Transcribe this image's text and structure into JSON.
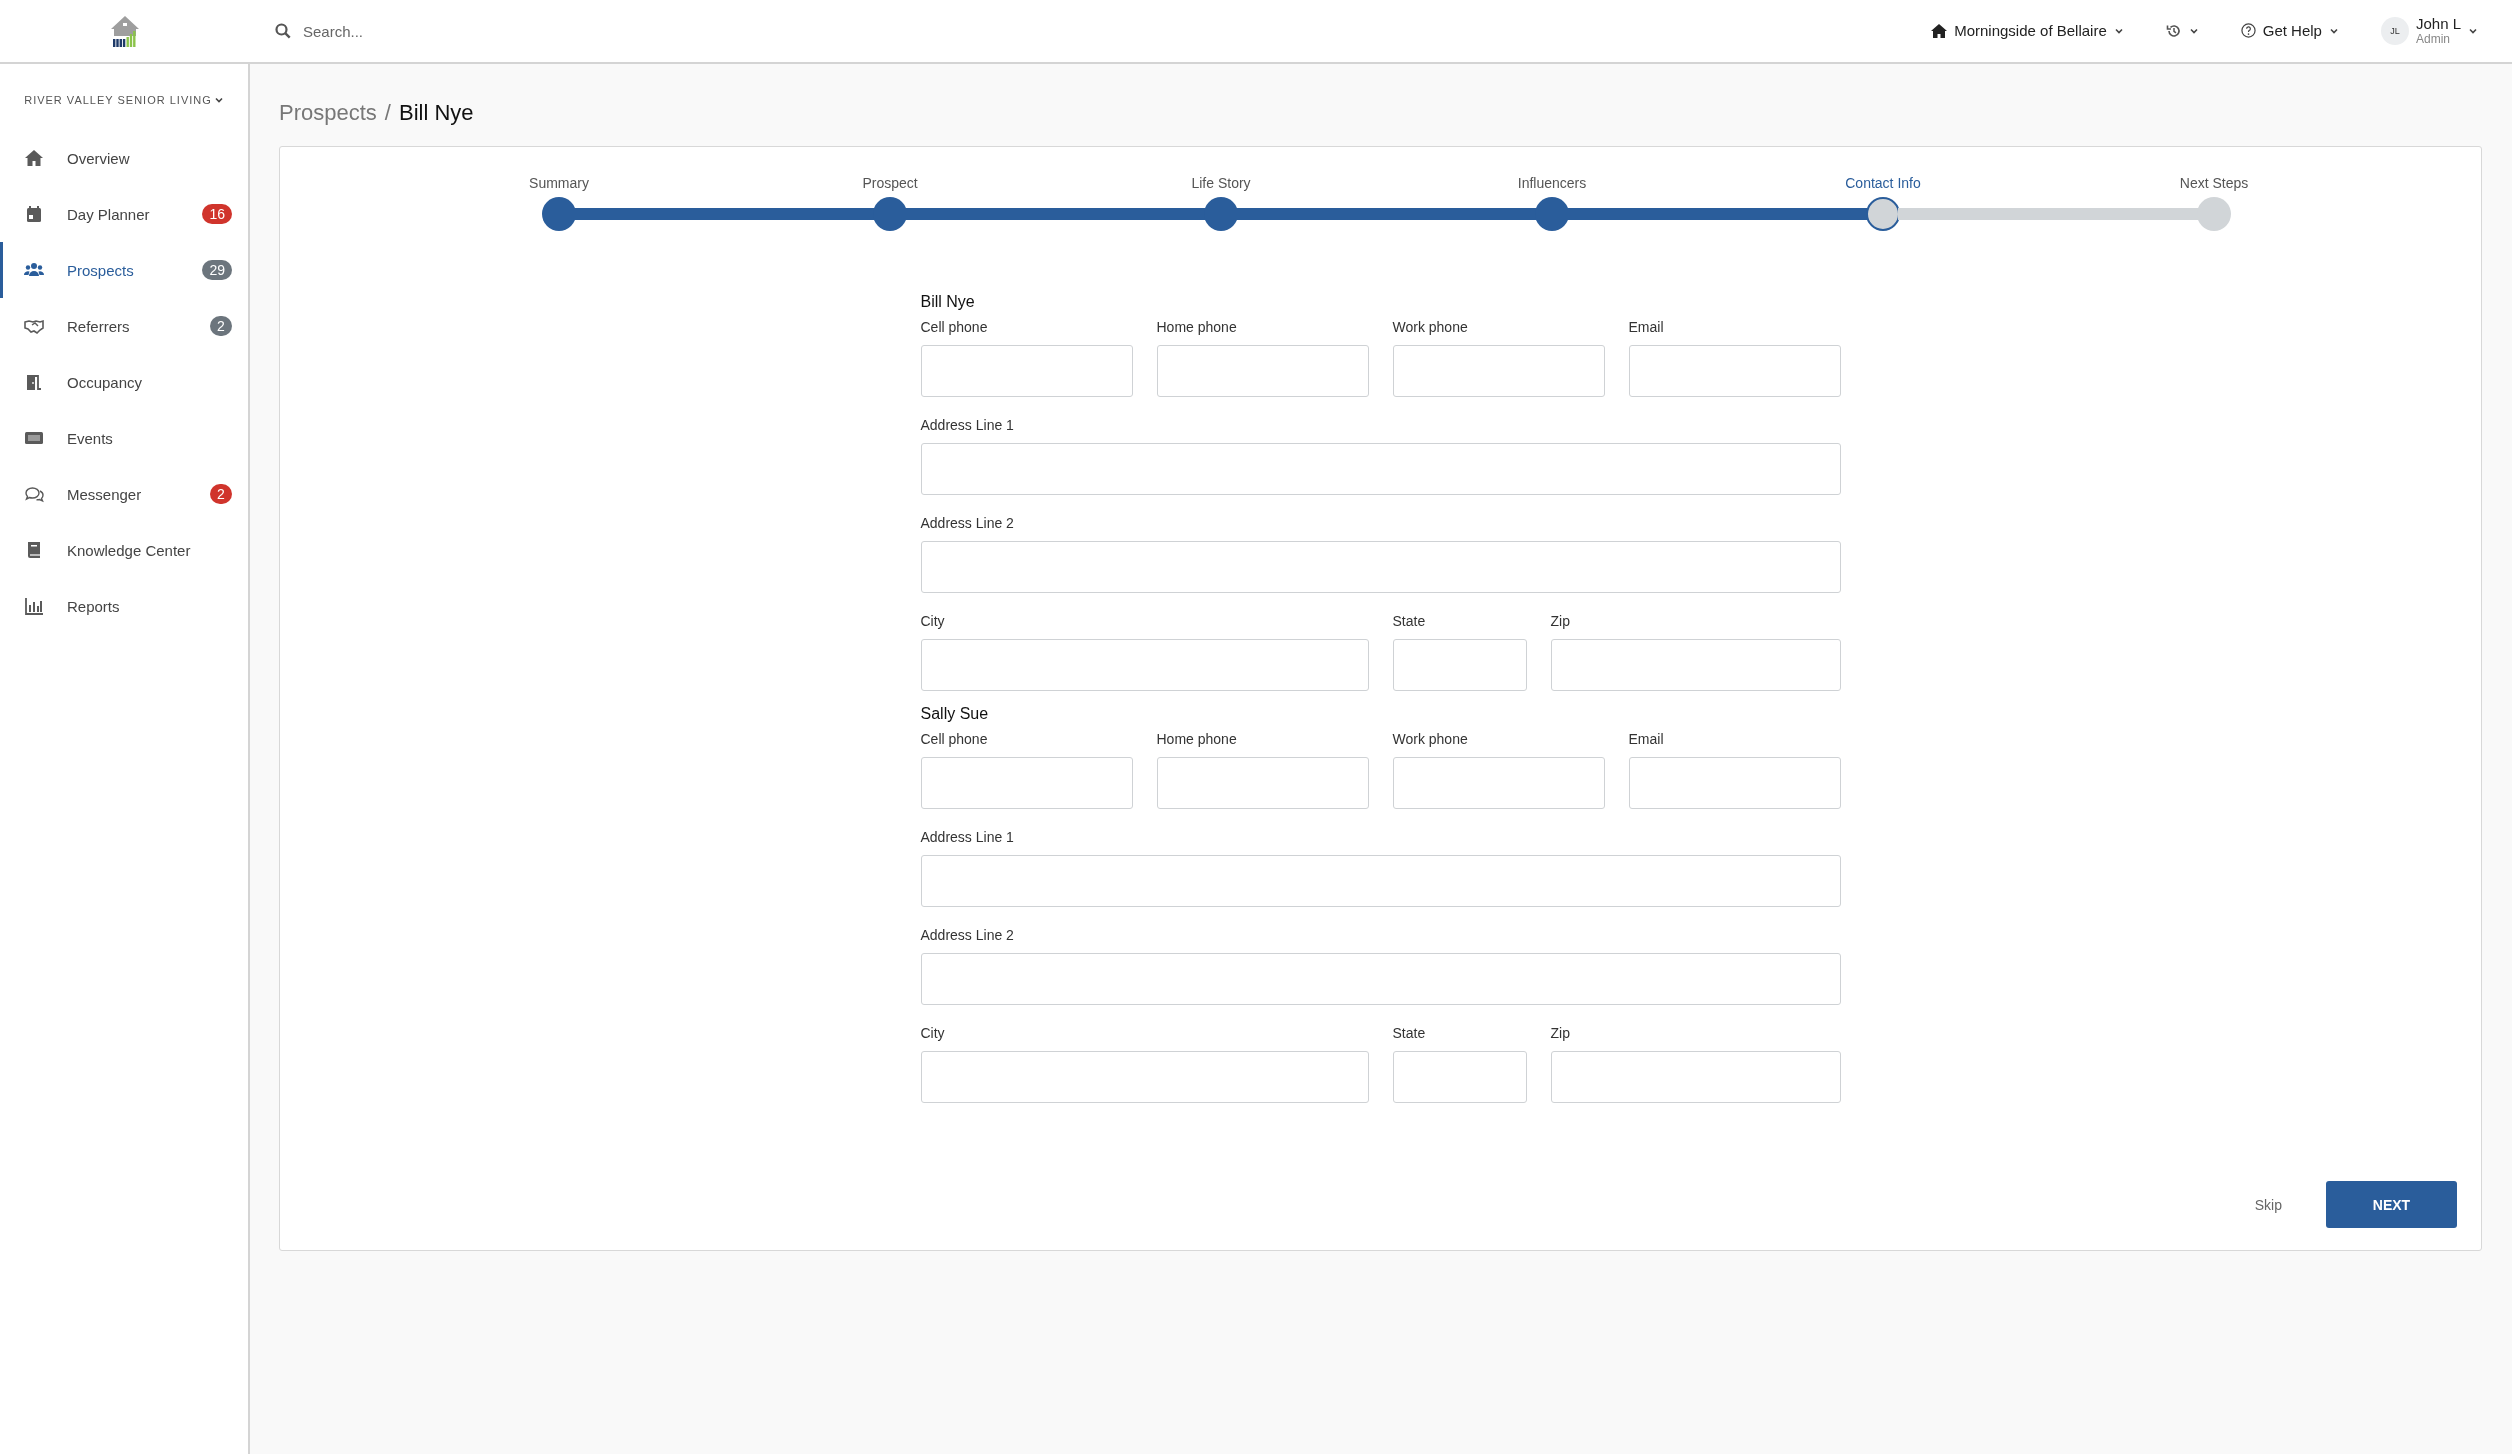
{
  "topbar": {
    "search": {
      "placeholder": "Search..."
    },
    "location": "Morningside of Bellaire",
    "help": "Get Help",
    "user": {
      "initials": "JL",
      "name": "John L",
      "role": "Admin"
    }
  },
  "sidebar": {
    "organization": "RIVER VALLEY SENIOR LIVING",
    "items": [
      {
        "label": "Overview",
        "selected": false
      },
      {
        "label": "Day Planner",
        "selected": false,
        "badge": "16",
        "color": "#d0342c"
      },
      {
        "label": "Prospects",
        "selected": true,
        "badge": "29",
        "color": "#6c757d"
      },
      {
        "label": "Referrers",
        "selected": false,
        "badge": "2",
        "color": "#6c757d"
      },
      {
        "label": "Occupancy",
        "selected": false
      },
      {
        "label": "Events",
        "selected": false
      },
      {
        "label": "Messenger",
        "selected": false,
        "badge": "2",
        "color": "#d0342c"
      },
      {
        "label": "Knowledge Center",
        "selected": false
      },
      {
        "label": "Reports",
        "selected": false
      }
    ]
  },
  "breadcrumb": {
    "parent": "Prospects",
    "separator": "/",
    "current": "Bill Nye"
  },
  "stepper": {
    "steps": [
      {
        "label": "Summary",
        "completed": true,
        "selected": false
      },
      {
        "label": "Prospect",
        "completed": true,
        "selected": false
      },
      {
        "label": "Life Story",
        "completed": true,
        "selected": false
      },
      {
        "label": "Influencers",
        "completed": true,
        "selected": false
      },
      {
        "label": "Contact Info",
        "completed": false,
        "selected": true
      },
      {
        "label": "Next Steps",
        "completed": false,
        "selected": false
      }
    ]
  },
  "contacts": [
    {
      "name": "Bill Nye",
      "fields": [
        {
          "label": "Cell phone",
          "kind": "quarter"
        },
        {
          "label": "Home phone",
          "kind": "quarter"
        },
        {
          "label": "Work phone",
          "kind": "quarter"
        },
        {
          "label": "Email",
          "kind": "quarter"
        },
        {
          "label": "Address Line 1",
          "kind": "full"
        },
        {
          "label": "Address Line 2",
          "kind": "full"
        },
        {
          "label": "City",
          "kind": "wide"
        },
        {
          "label": "State",
          "kind": "narrow"
        },
        {
          "label": "Zip",
          "kind": "medium"
        }
      ]
    },
    {
      "name": "Sally Sue",
      "fields": [
        {
          "label": "Cell phone",
          "kind": "quarter"
        },
        {
          "label": "Home phone",
          "kind": "quarter"
        },
        {
          "label": "Work phone",
          "kind": "quarter"
        },
        {
          "label": "Email",
          "kind": "quarter"
        },
        {
          "label": "Address Line 1",
          "kind": "full"
        },
        {
          "label": "Address Line 2",
          "kind": "full"
        },
        {
          "label": "City",
          "kind": "wide"
        },
        {
          "label": "State",
          "kind": "narrow"
        },
        {
          "label": "Zip",
          "kind": "medium"
        }
      ]
    }
  ],
  "actions": {
    "skip": "Skip",
    "next": "NEXT"
  }
}
